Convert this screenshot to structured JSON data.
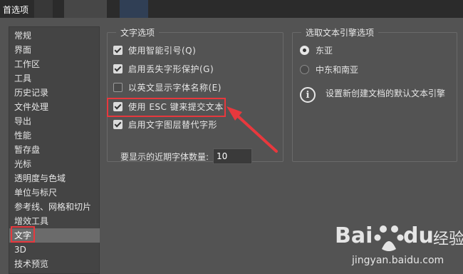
{
  "window": {
    "title": "首选项"
  },
  "sidebar": {
    "items": [
      {
        "label": "常规"
      },
      {
        "label": "界面"
      },
      {
        "label": "工作区"
      },
      {
        "label": "工具"
      },
      {
        "label": "历史记录"
      },
      {
        "label": "文件处理"
      },
      {
        "label": "导出"
      },
      {
        "label": "性能"
      },
      {
        "label": "暂存盘"
      },
      {
        "label": "光标"
      },
      {
        "label": "透明度与色域"
      },
      {
        "label": "单位与标尺"
      },
      {
        "label": "参考线、网格和切片"
      },
      {
        "label": "增效工具"
      },
      {
        "label": "文字",
        "selected": true
      },
      {
        "label": "3D"
      },
      {
        "label": "技术预览"
      }
    ]
  },
  "text_options": {
    "legend": "文字选项",
    "checkboxes": [
      {
        "label": "使用智能引号(Q)",
        "checked": true
      },
      {
        "label": "启用丢失字形保护(G)",
        "checked": true
      },
      {
        "label": "以英文显示字体名称(E)",
        "checked": false
      },
      {
        "label": "使用 ESC 键来提交文本",
        "checked": true
      },
      {
        "label": "启用文字图层替代字形",
        "checked": true
      }
    ],
    "recent_fonts_label": "要显示的近期字体数量:",
    "recent_fonts_value": "10"
  },
  "engine_options": {
    "legend": "选取文本引擎选项",
    "radios": [
      {
        "label": "东亚",
        "selected": true
      },
      {
        "label": "中东和南亚",
        "selected": false
      }
    ],
    "info_text": "设置新创建文档的默认文本引擎"
  },
  "watermark": {
    "brand": "Bai",
    "brand2": "du",
    "jingyan": "经验",
    "url": "jingyan.baidu.com"
  },
  "colors": {
    "highlight": "#e8383d",
    "selected_item": "#6b6b6b",
    "panel_bg": "#535353"
  }
}
